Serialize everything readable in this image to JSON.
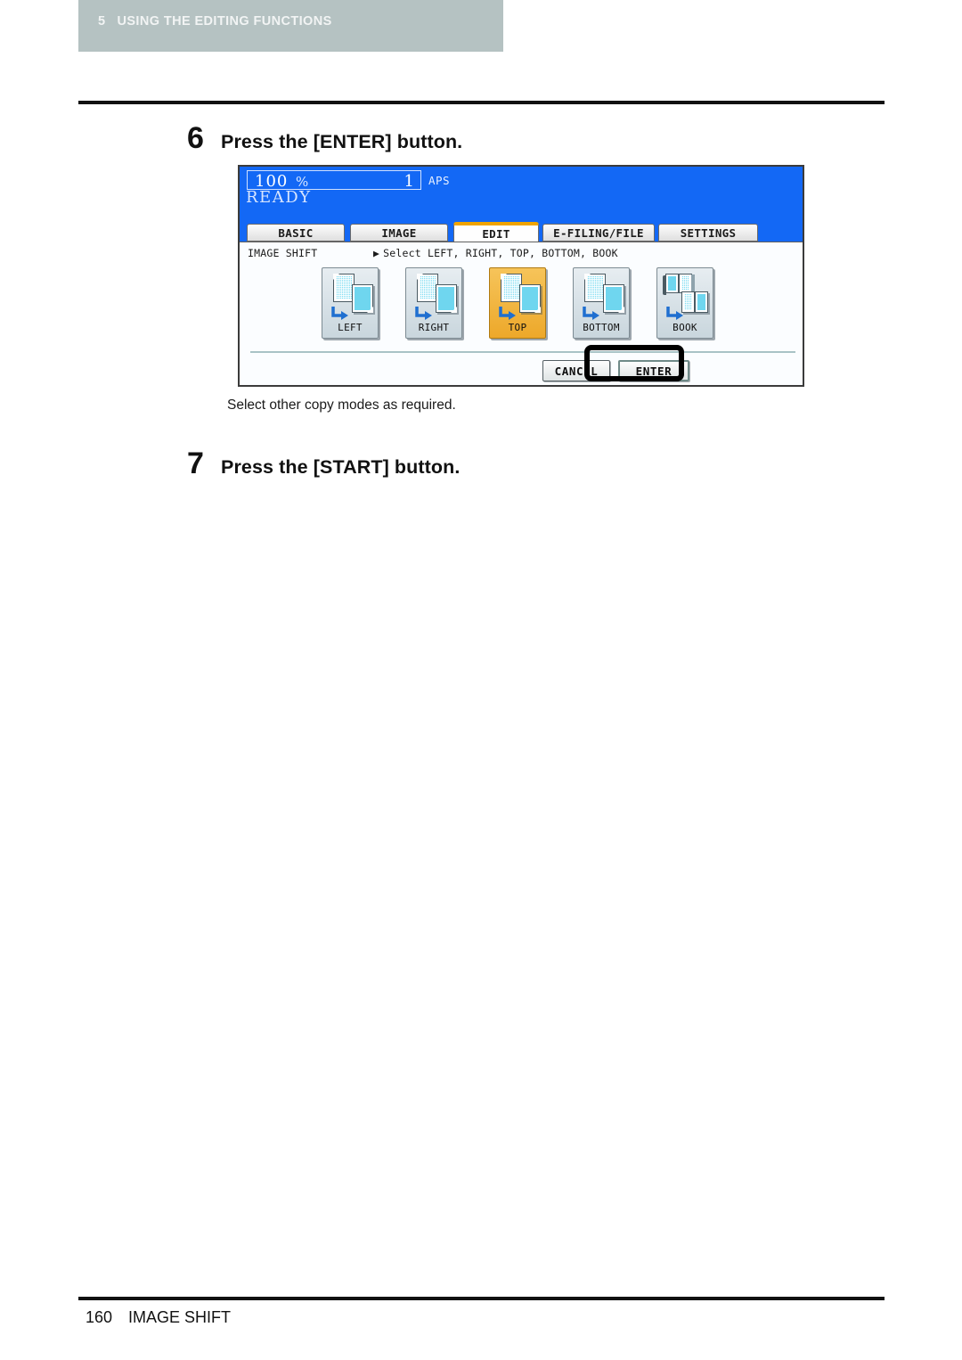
{
  "page": {
    "chapter_number": "5",
    "chapter_title": "USING THE EDITING FUNCTIONS",
    "banner_color": "#b5c2c2",
    "footer_page_number": "160",
    "footer_section": "IMAGE SHIFT"
  },
  "steps": [
    {
      "number": "6",
      "title": "Press the [ENTER] button."
    },
    {
      "number": "7",
      "title": "Press the [START] button."
    }
  ],
  "note": "Select other copy modes as required.",
  "lcd": {
    "background_color": "#1368f5",
    "status": {
      "zoom_ratio": "100",
      "percent_symbol": "%",
      "copy_count": "1",
      "paper_mode": "APS",
      "machine_state": "READY"
    },
    "tabs": [
      {
        "label": "BASIC",
        "active": false
      },
      {
        "label": "IMAGE",
        "active": false
      },
      {
        "label": "EDIT",
        "active": true
      },
      {
        "label": "E-FILING/FILE",
        "active": false
      },
      {
        "label": "SETTINGS",
        "active": false
      }
    ],
    "active_tab_accent": "#f0a400",
    "function_name": "IMAGE SHIFT",
    "function_hint": "Select LEFT, RIGHT, TOP, BOTTOM, BOOK",
    "hint_caret": "▶",
    "options": [
      {
        "label": "LEFT",
        "icon": "page-shift-left-icon",
        "selected": false
      },
      {
        "label": "RIGHT",
        "icon": "page-shift-right-icon",
        "selected": false
      },
      {
        "label": "TOP",
        "icon": "page-shift-top-icon",
        "selected": true
      },
      {
        "label": "BOTTOM",
        "icon": "page-shift-bottom-icon",
        "selected": false
      },
      {
        "label": "BOOK",
        "icon": "book-shift-icon",
        "selected": false
      }
    ],
    "selected_option_color": "#eda82a",
    "actions": {
      "cancel_label": "CANCEL",
      "enter_label": "ENTER"
    }
  },
  "callout": {
    "target": "ENTER",
    "color": "#000000"
  }
}
